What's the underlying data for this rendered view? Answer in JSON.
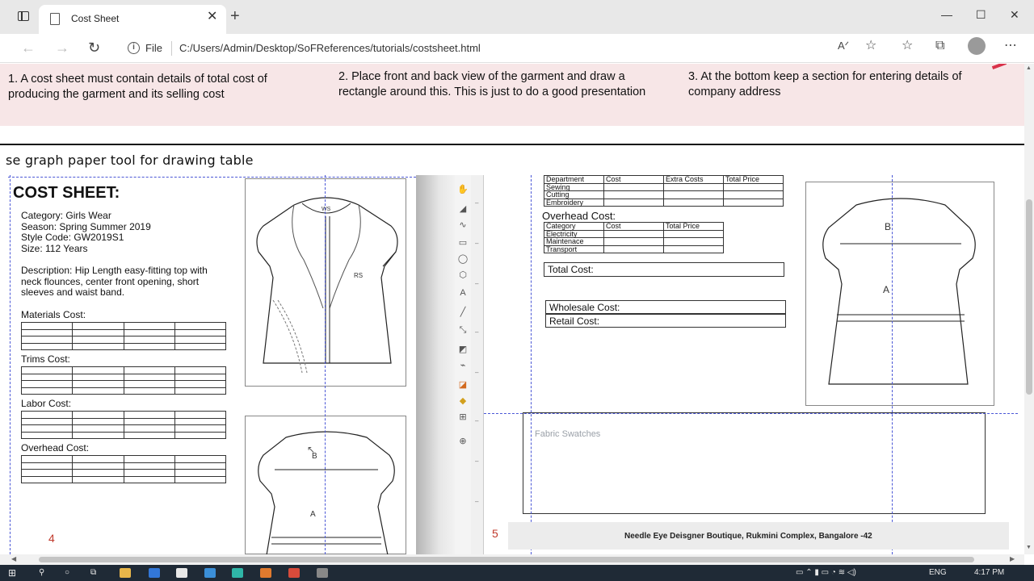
{
  "browser": {
    "tab_title": "Cost Sheet",
    "address_scheme": "File",
    "url": "C:/Users/Admin/Desktop/SoFReferences/tutorials/costsheet.html",
    "icons": [
      "tab-actions-icon",
      "back-icon",
      "forward-icon",
      "refresh-icon",
      "info-icon",
      "read-aloud-icon",
      "add-favorite-icon",
      "favorites-icon",
      "collections-icon",
      "profile-icon",
      "more-icon"
    ]
  },
  "notes": {
    "n1": "1. A cost sheet must contain details of total cost of producing the garment and its selling cost",
    "n2": "2. Place front and back view of the garment and draw a rectangle around this. This is just to do a good presentation",
    "n3": "3. At the bottom keep a section for entering details of company address"
  },
  "tip": "se graph paper tool for drawing table",
  "page4": {
    "title": "COST SHEET:",
    "category": "Category: Girls Wear",
    "season": "Season: Spring Summer 2019",
    "style_code": "Style Code: GW2019S1",
    "size": "Size: 112 Years",
    "description": "Description: Hip Length easy-fitting top with neck flounces, center front opening, short sleeves and waist band.",
    "sections": {
      "materials": "Materials Cost:",
      "trims": "Trims Cost:",
      "labor": "Labor Cost:",
      "overhead": "Overhead Cost:"
    },
    "sketch_labels": {
      "front_ws": "WS",
      "front_rs": "RS",
      "back_b": "B",
      "back_a": "A"
    },
    "page_number": "4"
  },
  "page5": {
    "labor_table": {
      "headers": [
        "Department",
        "Cost",
        "Extra Costs",
        "Total Price"
      ],
      "rows": [
        "Sewing",
        "Cutting",
        "Embroidery"
      ]
    },
    "overhead_label": "Overhead Cost:",
    "overhead_table": {
      "headers": [
        "Category",
        "Cost",
        "Total Price"
      ],
      "rows": [
        "Electricity",
        "Maintenace",
        "Transport"
      ]
    },
    "total_cost": "Total Cost:",
    "wholesale_cost": "Wholesale Cost:",
    "retail_cost": "Retail Cost:",
    "sketch_labels": {
      "back_b": "B",
      "back_a": "A"
    },
    "fabric_swatches": "Fabric Swatches",
    "footer": "Needle Eye Deisgner Boutique, Rukmini Complex, Bangalore -42",
    "page_number": "5"
  },
  "taskbar": {
    "language": "ENG",
    "time": "4:17 PM"
  },
  "colors": {
    "notes_band": "#f7e6e7",
    "guide_lines": "#4a57d6",
    "page_number": "#c0392b",
    "taskbar": "#1f2a36"
  }
}
